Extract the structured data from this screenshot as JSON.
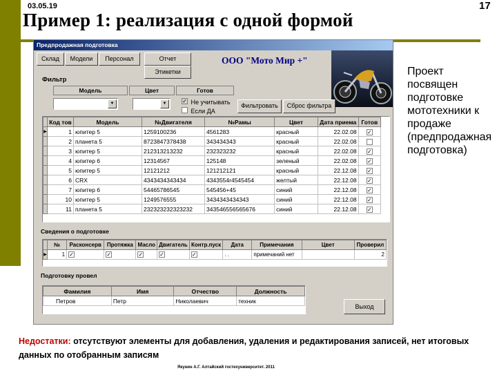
{
  "slide": {
    "date": "03.05.19",
    "number": "17",
    "title": "Пример 1: реализация с одной формой",
    "side_text": "Проект посвящен подготовке мототехники к продаже (предпродажная подготовка)",
    "drawbacks_label": "Недостатки:",
    "drawbacks_text": " отсутствуют элементы для добавления, удаления и редактирования записей, нет итоговых данных по отобранным записям",
    "footer": "Якунин А.Г. Алтайский гостехуниверситет. 2011",
    "accent_color": "#808000"
  },
  "app": {
    "window_title": "Предпродажная подготовка",
    "menu": {
      "warehouse": "Склад",
      "models": "Модели",
      "staff": "Персонал",
      "report": "Отчет",
      "labels": "Этикетки"
    },
    "company": "ООО \"Мото Мир +\"",
    "filter": {
      "title": "Фильтр",
      "model_label": "Модель",
      "color_label": "Цвет",
      "ready_label": "Готов",
      "ignore_label": "Не учитывать",
      "if_yes_label": "Если ДА",
      "filter_button": "Фильтровать",
      "reset_button": "Сброс фильтра"
    },
    "main_grid": {
      "columns": [
        "Код тов",
        "Модель",
        "№Двигателя",
        "№Рамы",
        "Цвет",
        "Дата приема",
        "Готов"
      ],
      "rows": [
        {
          "code": "1",
          "model": "юпитер 5",
          "engine": "1259100236",
          "frame": "4561283",
          "color": "красный",
          "date": "22.02.08",
          "ready": true
        },
        {
          "code": "2",
          "model": "планета 5",
          "engine": "8723847378438",
          "frame": "343434343",
          "color": "красный",
          "date": "22.02.08",
          "ready": false
        },
        {
          "code": "3",
          "model": "юпитер 5",
          "engine": "212313213232",
          "frame": "232323232",
          "color": "красный",
          "date": "22.02.08",
          "ready": true
        },
        {
          "code": "4",
          "model": "юпитер 6",
          "engine": "12314567",
          "frame": "125148",
          "color": "зеленый",
          "date": "22.02.08",
          "ready": true
        },
        {
          "code": "5",
          "model": "юпитер 5",
          "engine": "12121212",
          "frame": "121212121",
          "color": "красный",
          "date": "22.12.08",
          "ready": true
        },
        {
          "code": "6",
          "model": "CRX",
          "engine": "4343434343434",
          "frame": "4343554r4545454",
          "color": "желтый",
          "date": "22.12.08",
          "ready": true
        },
        {
          "code": "7",
          "model": "юпитер 6",
          "engine": "54465786545",
          "frame": "545456+45",
          "color": "синий",
          "date": "22.12.08",
          "ready": true
        },
        {
          "code": "10",
          "model": "юпитер 5",
          "engine": "1249576555",
          "frame": "3434343434343",
          "color": "синий",
          "date": "22.12.08",
          "ready": true
        },
        {
          "code": "11",
          "model": "планета 5",
          "engine": "232323232323232",
          "frame": "343546556565676",
          "color": "синий",
          "date": "22.12.08",
          "ready": true
        }
      ]
    },
    "prep_info": {
      "title": "Сведения о подготовке",
      "columns": [
        "№",
        "Расконсерв",
        "Протяжка",
        "Масло",
        "Двигатель",
        "Контр.пуск",
        "Дата",
        "Примечания",
        "Цвет",
        "Проверил"
      ],
      "row": {
        "num": "1",
        "date": ". .",
        "notes": "примечаний нет",
        "checked": "2"
      }
    },
    "prepared_by": {
      "title": "Подготовку провел",
      "columns": [
        "Фамилия",
        "Имя",
        "Отчество",
        "Должность"
      ],
      "row": {
        "last": "Петров",
        "first": "Петр",
        "middle": "Николаевич",
        "position": "техник"
      }
    },
    "exit_button": "Выход"
  }
}
